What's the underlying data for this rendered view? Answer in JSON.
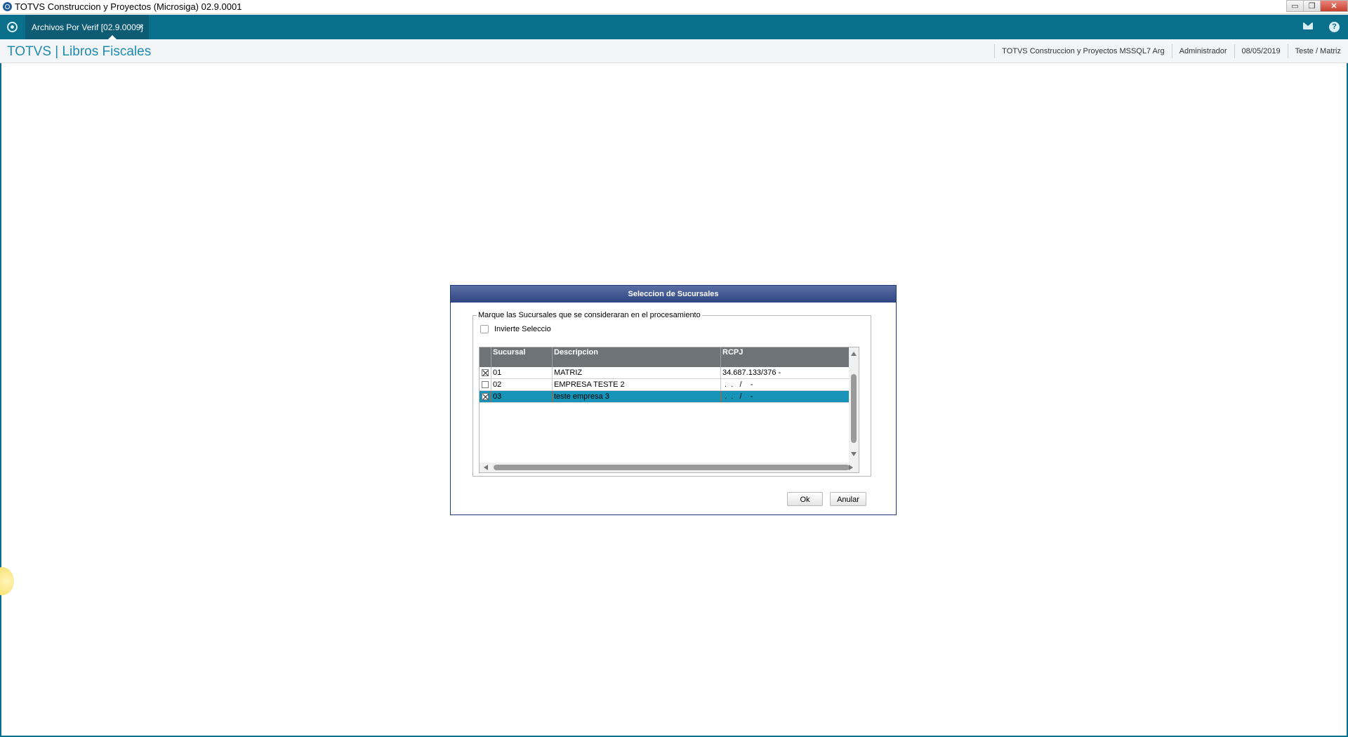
{
  "window": {
    "title": "TOTVS Construccion y Proyectos (Microsiga) 02.9.0001",
    "controls": {
      "minimize": "▭",
      "restore": "❐",
      "close": "✕"
    }
  },
  "tabbar": {
    "tabs": [
      {
        "label": "Archivos Por Verif [02.9.0009]",
        "close": "×"
      }
    ],
    "help_label": "?"
  },
  "header": {
    "brand": "TOTVS | Libros Fiscales",
    "company": "TOTVS Construccion y Proyectos MSSQL7 Arg",
    "user": "Administrador",
    "date": "08/05/2019",
    "branch": "Teste / Matriz"
  },
  "dialog": {
    "title": "Seleccion de Sucursales",
    "group_label": "Marque las Sucursales que se consideraran en el procesamiento",
    "invert_label": "Invierte Seleccio",
    "invert_checked": false,
    "columns": [
      "Sucursal",
      "Descripcion",
      "RCPJ"
    ],
    "rows": [
      {
        "checked": true,
        "sucursal": "01",
        "descripcion": "MATRIZ",
        "rcpj": "34.687.133/376 -",
        "selected": false
      },
      {
        "checked": false,
        "sucursal": "02",
        "descripcion": "EMPRESA TESTE 2",
        "rcpj": " .  .   /    -",
        "selected": false
      },
      {
        "checked": true,
        "sucursal": "03",
        "descripcion": "teste empresa 3",
        "rcpj": " .  .   /    -",
        "selected": true
      }
    ],
    "ok_label": "Ok",
    "cancel_label": "Anular"
  },
  "colors": {
    "tabbar": "#096f8b",
    "brand_text": "#1d8cb3",
    "selected_row": "#1693b6",
    "dialog_title": "#2f4683",
    "grid_header": "#6e7378"
  }
}
